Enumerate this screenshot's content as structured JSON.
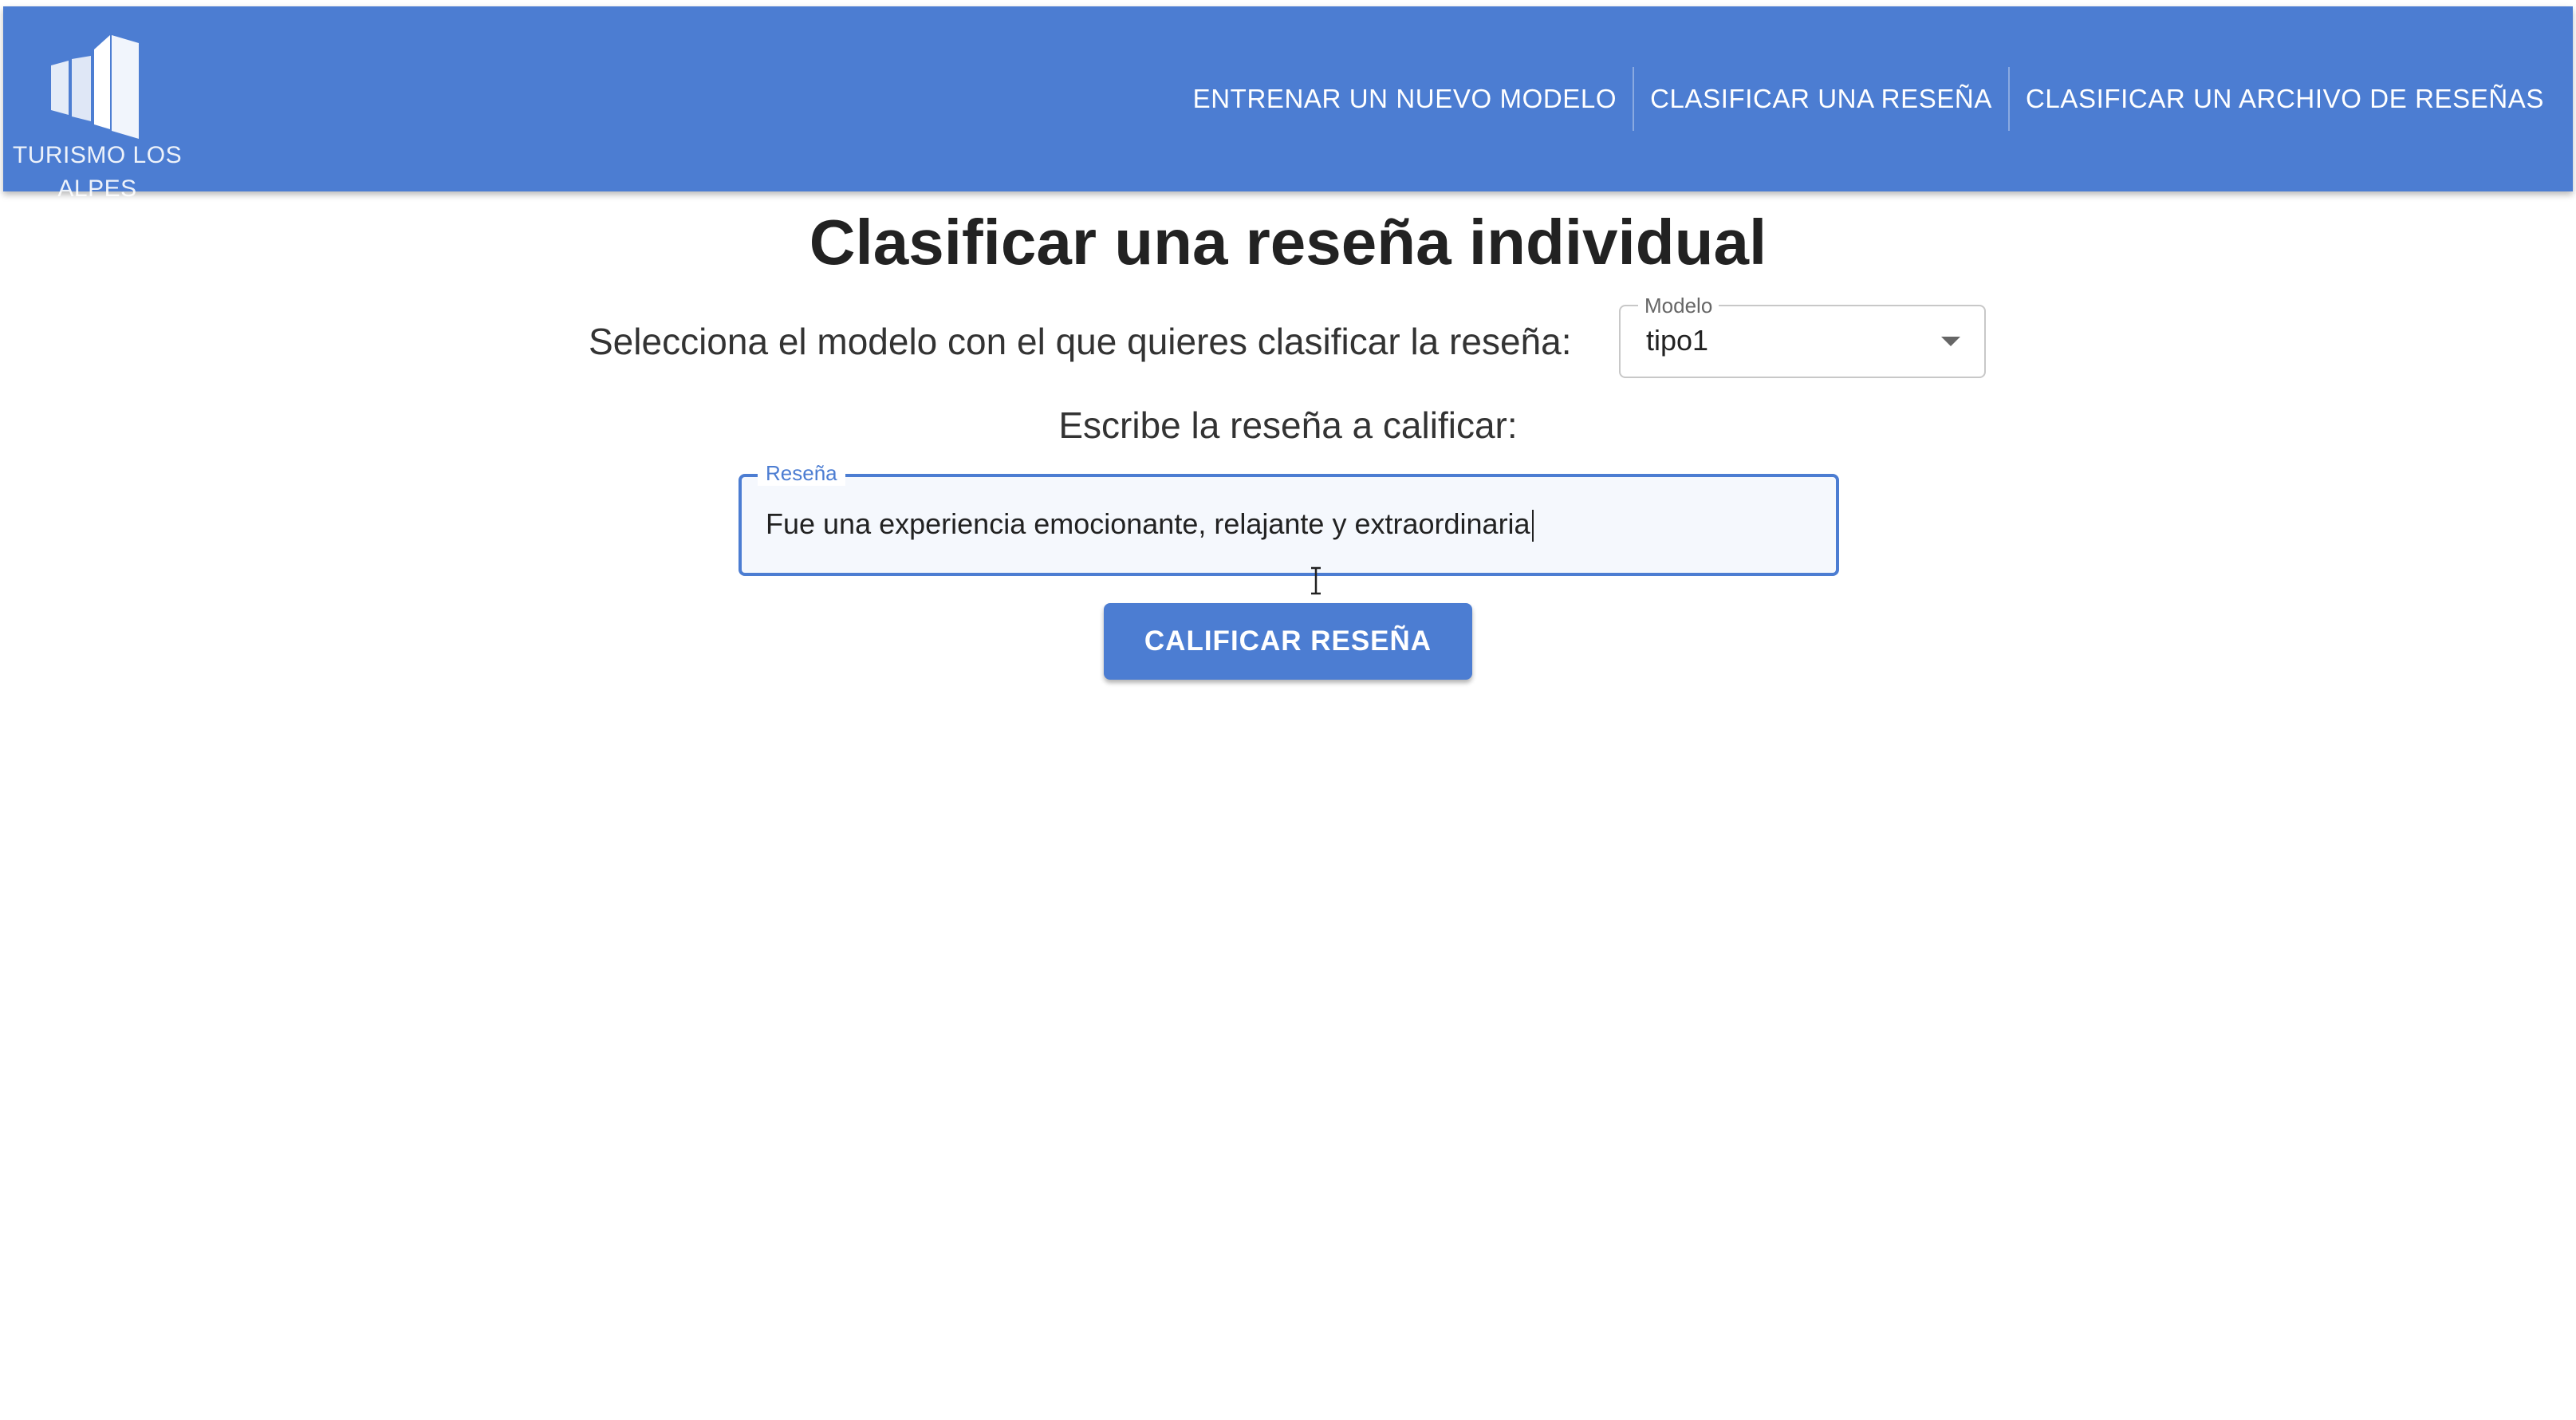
{
  "brand": {
    "name": "TURISMO LOS\nALPES",
    "logo_icon": "building-icon"
  },
  "nav": {
    "items": [
      {
        "label": "ENTRENAR UN NUEVO MODELO"
      },
      {
        "label": "CLASIFICAR UNA RESEÑA"
      },
      {
        "label": "CLASIFICAR UN ARCHIVO DE RESEÑAS"
      }
    ]
  },
  "main": {
    "title": "Clasificar una reseña individual",
    "model_prompt": "Selecciona el modelo con el que quieres clasificar la reseña:",
    "model_select": {
      "label": "Modelo",
      "value": "tipo1"
    },
    "review_prompt": "Escribe la reseña a calificar:",
    "review_field": {
      "label": "Reseña",
      "value": "Fue una experiencia emocionante, relajante y extraordinaria"
    },
    "submit_label": "CALIFICAR RESEÑA"
  },
  "colors": {
    "primary": "#4c7dd2",
    "text": "#222222"
  }
}
